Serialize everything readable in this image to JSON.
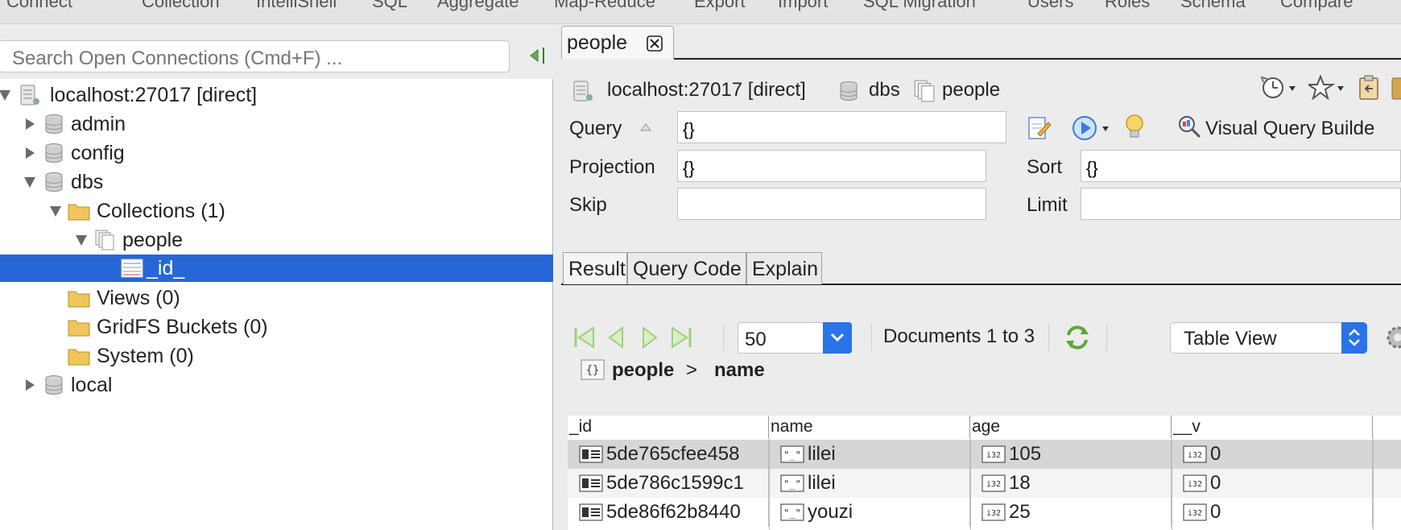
{
  "toolbar": {
    "items": [
      "Connect",
      "Collection",
      "IntelliShell",
      "SQL",
      "Aggregate",
      "Map-Reduce",
      "Export",
      "Import",
      "SQL Migration",
      "Users",
      "Roles",
      "Schema",
      "Compare"
    ]
  },
  "sidebar": {
    "search_placeholder": "Search Open Connections (Cmd+F) ...",
    "tree": [
      {
        "label": "localhost:27017 [direct]",
        "icon": "server-icon"
      },
      {
        "label": "admin",
        "icon": "database-icon"
      },
      {
        "label": "config",
        "icon": "database-icon"
      },
      {
        "label": "dbs",
        "icon": "database-icon"
      },
      {
        "label": "Collections (1)",
        "icon": "folder-icon"
      },
      {
        "label": "people",
        "icon": "collection-icon"
      },
      {
        "label": "_id_",
        "icon": "index-icon"
      },
      {
        "label": "Views (0)",
        "icon": "folder-icon"
      },
      {
        "label": "GridFS Buckets (0)",
        "icon": "folder-icon"
      },
      {
        "label": "System (0)",
        "icon": "folder-icon"
      },
      {
        "label": "local",
        "icon": "database-icon"
      }
    ]
  },
  "tab": {
    "label": "people"
  },
  "breadcrumb": {
    "server": "localhost:27017 [direct]",
    "database": "dbs",
    "collection": "people"
  },
  "query": {
    "query_label": "Query",
    "query_value": "{}",
    "projection_label": "Projection",
    "projection_value": "{}",
    "sort_label": "Sort",
    "sort_value": "{}",
    "skip_label": "Skip",
    "skip_value": "",
    "limit_label": "Limit",
    "limit_value": "",
    "visual_builder_label": "Visual Query Builde"
  },
  "subtabs": [
    "Result",
    "Query Code",
    "Explain"
  ],
  "pager": {
    "page_size": "50",
    "documents_text": "Documents 1 to 3",
    "view_mode": "Table View"
  },
  "path": {
    "root": "people",
    "separator": ">",
    "field": "name"
  },
  "table": {
    "columns": [
      "_id",
      "name",
      "age",
      "__v"
    ],
    "rows": [
      {
        "_id": "5de765cfee458",
        "name": "lilei",
        "age": "105",
        "__v": "0"
      },
      {
        "_id": "5de786c1599c1",
        "name": "lilei",
        "age": "18",
        "__v": "0"
      },
      {
        "_id": "5de86f62b8440",
        "name": "youzi",
        "age": "25",
        "__v": "0"
      }
    ]
  },
  "colors": {
    "selection": "#2667d8",
    "accent": "#2a73e8",
    "folder": "#f0c65a"
  }
}
